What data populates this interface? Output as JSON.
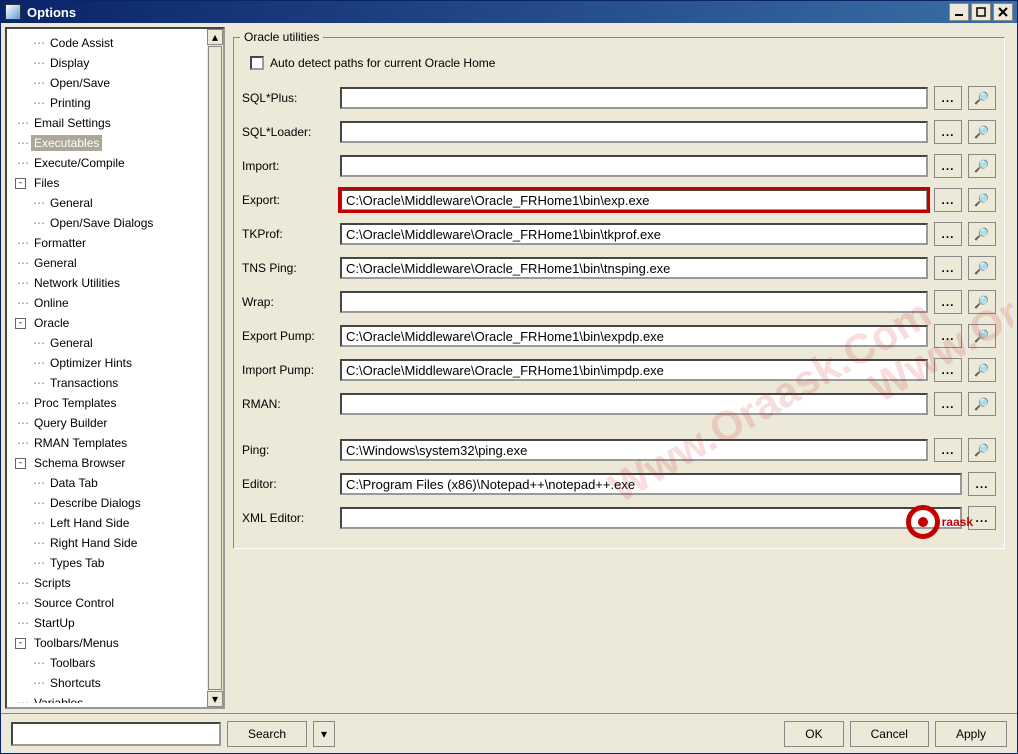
{
  "window": {
    "title": "Options"
  },
  "tree": {
    "items": [
      {
        "level": 2,
        "label": "Code Assist"
      },
      {
        "level": 2,
        "label": "Display"
      },
      {
        "level": 2,
        "label": "Open/Save"
      },
      {
        "level": 2,
        "label": "Printing"
      },
      {
        "level": 1,
        "label": "Email Settings"
      },
      {
        "level": 1,
        "label": "Executables",
        "selected": true
      },
      {
        "level": 1,
        "label": "Execute/Compile"
      },
      {
        "level": 1,
        "label": "Files",
        "toggle": "-"
      },
      {
        "level": 2,
        "label": "General"
      },
      {
        "level": 2,
        "label": "Open/Save Dialogs"
      },
      {
        "level": 1,
        "label": "Formatter"
      },
      {
        "level": 1,
        "label": "General"
      },
      {
        "level": 1,
        "label": "Network Utilities"
      },
      {
        "level": 1,
        "label": "Online"
      },
      {
        "level": 1,
        "label": "Oracle",
        "toggle": "-"
      },
      {
        "level": 2,
        "label": "General"
      },
      {
        "level": 2,
        "label": "Optimizer Hints"
      },
      {
        "level": 2,
        "label": "Transactions"
      },
      {
        "level": 1,
        "label": "Proc Templates"
      },
      {
        "level": 1,
        "label": "Query Builder"
      },
      {
        "level": 1,
        "label": "RMAN Templates"
      },
      {
        "level": 1,
        "label": "Schema Browser",
        "toggle": "-"
      },
      {
        "level": 2,
        "label": "Data Tab"
      },
      {
        "level": 2,
        "label": "Describe Dialogs"
      },
      {
        "level": 2,
        "label": "Left Hand Side"
      },
      {
        "level": 2,
        "label": "Right Hand Side"
      },
      {
        "level": 2,
        "label": "Types Tab"
      },
      {
        "level": 1,
        "label": "Scripts"
      },
      {
        "level": 1,
        "label": "Source Control"
      },
      {
        "level": 1,
        "label": "StartUp"
      },
      {
        "level": 1,
        "label": "Toolbars/Menus",
        "toggle": "-"
      },
      {
        "level": 2,
        "label": "Toolbars"
      },
      {
        "level": 2,
        "label": "Shortcuts"
      },
      {
        "level": 1,
        "label": "Variables"
      }
    ]
  },
  "main": {
    "group_title": "Oracle utilities",
    "auto_detect_label": "Auto detect paths for current Oracle Home",
    "fields": [
      {
        "label": "SQL*Plus:",
        "value": ""
      },
      {
        "label": "SQL*Loader:",
        "value": ""
      },
      {
        "label": "Import:",
        "value": ""
      },
      {
        "label": "Export:",
        "value": "C:\\Oracle\\Middleware\\Oracle_FRHome1\\bin\\exp.exe",
        "highlighted": true
      },
      {
        "label": "TKProf:",
        "value": "C:\\Oracle\\Middleware\\Oracle_FRHome1\\bin\\tkprof.exe"
      },
      {
        "label": "TNS Ping:",
        "value": "C:\\Oracle\\Middleware\\Oracle_FRHome1\\bin\\tnsping.exe"
      },
      {
        "label": "Wrap:",
        "value": ""
      },
      {
        "label": "Export Pump:",
        "value": "C:\\Oracle\\Middleware\\Oracle_FRHome1\\bin\\expdp.exe"
      },
      {
        "label": "Import Pump:",
        "value": "C:\\Oracle\\Middleware\\Oracle_FRHome1\\bin\\impdp.exe"
      },
      {
        "label": "RMAN:",
        "value": ""
      }
    ],
    "fields2": [
      {
        "label": "Ping:",
        "value": "C:\\Windows\\system32\\ping.exe",
        "find": true
      },
      {
        "label": "Editor:",
        "value": "C:\\Program Files (x86)\\Notepad++\\notepad++.exe",
        "find": false
      },
      {
        "label": "XML Editor:",
        "value": "",
        "find": false
      }
    ],
    "browse_label": "...",
    "find_glyph": "👀"
  },
  "footer": {
    "search_label": "Search",
    "ok_label": "OK",
    "cancel_label": "Cancel",
    "apply_label": "Apply"
  },
  "watermark": "Www.Oraask.Com",
  "logo": "raask"
}
